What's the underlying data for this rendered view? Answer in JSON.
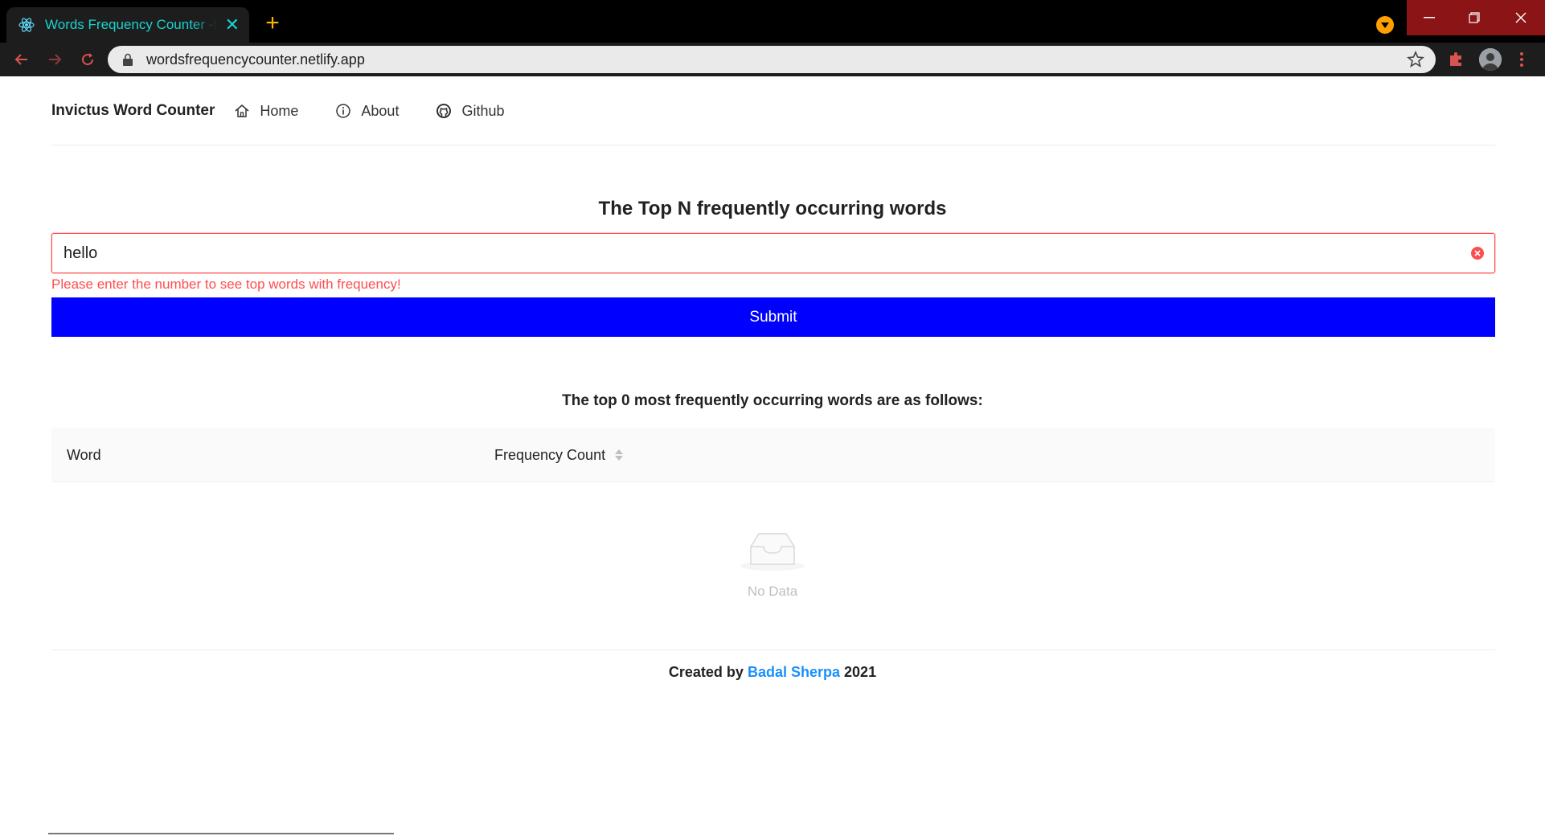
{
  "browser": {
    "tab_title": "Words Frequency Counter -Badal Sherpa",
    "url": "wordsfrequencycounter.netlify.app"
  },
  "nav": {
    "brand": "Invictus Word Counter",
    "links": [
      {
        "label": "Home",
        "icon": "home-icon"
      },
      {
        "label": "About",
        "icon": "info-icon"
      },
      {
        "label": "Github",
        "icon": "github-icon"
      }
    ]
  },
  "form": {
    "heading": "The Top N frequently occurring words",
    "input_value": "hello",
    "error": "Please enter the number to see top words with frequency!",
    "submit_label": "Submit"
  },
  "results": {
    "heading": "The top 0 most frequently occurring words are as follows:",
    "columns": [
      "Word",
      "Frequency Count"
    ],
    "empty_text": "No Data"
  },
  "footer": {
    "prefix": "Created by",
    "author": "Badal Sherpa",
    "year": "2021"
  },
  "colors": {
    "accent_button": "#0000ff",
    "error": "#ff4d4f",
    "link": "#1890ff",
    "tab_text": "#19d3cf",
    "window_controls": "#8a1416"
  }
}
